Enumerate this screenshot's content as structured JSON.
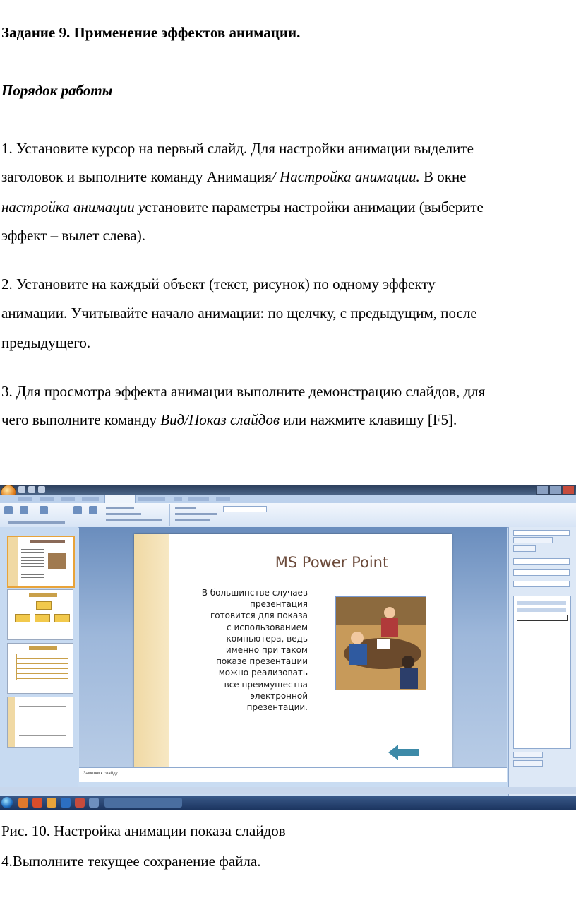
{
  "heading": "Задание 9. Применение эффектов анимации.",
  "subheading": "Порядок работы",
  "step1": {
    "line1": "1. Установите курсор на первый слайд. Для настройки анимации выделите",
    "line2_a": "заголовок и выполните команду Анимация",
    "line2_b": "/ Настройка анимации.",
    "line2_c": " В окне",
    "line3_a": "настройка анимации у",
    "line3_b": "становите параметры настройки анимации  (выберите",
    "line4": "эффект – вылет слева)."
  },
  "step2": {
    "line1": "2. Установите на каждый объект (текст, рисунок) по одному эффекту",
    "line2": "анимации. Учитывайте начало анимации: по щелчку, с предыдущим, после",
    "line3": "предыдущего."
  },
  "step3": {
    "line1": "3. Для просмотра эффекта анимации выполните демонстрацию слайдов, для",
    "line2_a": "чего выполните команду ",
    "line2_b": "Вид/Показ слайдов",
    "line2_c": " или нажмите клавишу [F5]."
  },
  "screenshot": {
    "slide_title": "MS Power Point",
    "slide_body": "В большинстве случаев\nпрезентация\nготовится для показа\nс использованием\nкомпьютера, ведь\nименно при таком\nпоказе презентации\nможно реализовать\nвсе преимущества\nэлектронной\nпрезентации.",
    "notes_placeholder": "Заметки к слайду",
    "icons": [
      "office-button-icon",
      "back-arrow-icon",
      "start-orb-icon"
    ]
  },
  "caption": "Рис. 10. Настройка анимации показа слайдов",
  "step4": "4.Выполните текущее сохранение файла."
}
